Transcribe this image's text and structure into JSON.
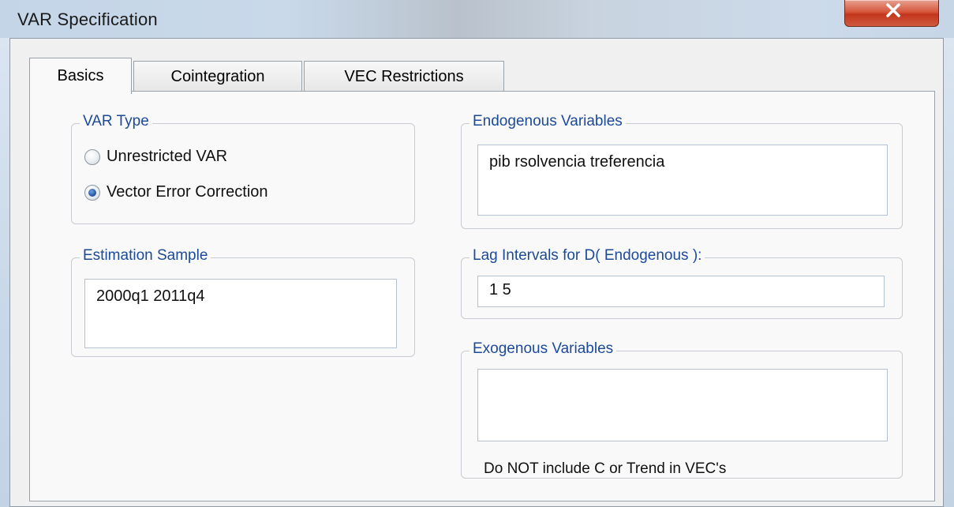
{
  "window": {
    "title": "VAR Specification",
    "close_label": "X"
  },
  "tabs": [
    {
      "label": "Basics",
      "active": true
    },
    {
      "label": "Cointegration",
      "active": false
    },
    {
      "label": "VEC Restrictions",
      "active": false
    }
  ],
  "var_type": {
    "caption": "VAR Type",
    "options": [
      {
        "label": "Unrestricted VAR",
        "selected": false
      },
      {
        "label": "Vector Error Correction",
        "selected": true
      }
    ]
  },
  "endogenous": {
    "caption": "Endogenous Variables",
    "value": "pib rsolvencia treferencia"
  },
  "estimation_sample": {
    "caption": "Estimation Sample",
    "value": "2000q1 2011q4"
  },
  "lag_intervals": {
    "caption": "Lag Intervals for D( Endogenous ):",
    "value": "1 5"
  },
  "exogenous": {
    "caption": "Exogenous Variables",
    "value": "",
    "note": "Do NOT include C or Trend in VEC's"
  }
}
